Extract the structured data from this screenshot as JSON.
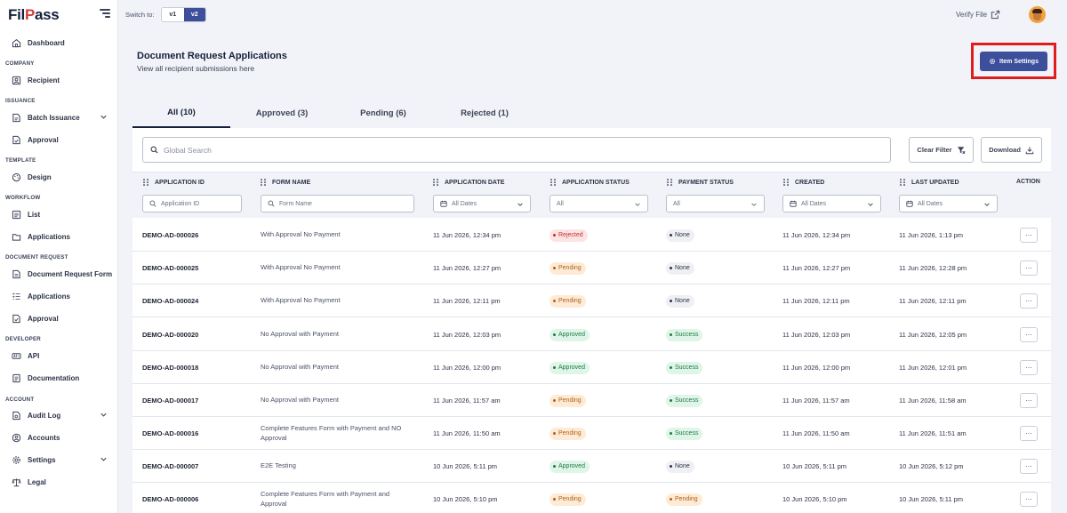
{
  "app": {
    "logo_main": "Fil",
    "logo_accent": "P",
    "logo_rest": "ass"
  },
  "sidebar": {
    "dashboard": "Dashboard",
    "sections": {
      "company": "COMPANY",
      "issuance": "ISSUANCE",
      "template": "TEMPLATE",
      "workflow": "WORKFLOW",
      "document_request": "DOCUMENT REQUEST",
      "developer": "DEVELOPER",
      "account": "ACCOUNT"
    },
    "items": {
      "recipient": "Recipient",
      "batch_issuance": "Batch Issuance",
      "approval": "Approval",
      "design": "Design",
      "list": "List",
      "applications": "Applications",
      "document_request_form": "Document Request Form",
      "dr_applications": "Applications",
      "dr_approval": "Approval",
      "api": "API",
      "documentation": "Documentation",
      "audit_log": "Audit Log",
      "accounts": "Accounts",
      "settings": "Settings",
      "legal": "Legal"
    }
  },
  "topbar": {
    "switch_label": "Switch to:",
    "v1": "v1",
    "v2": "v2",
    "verify_file": "Verify File"
  },
  "header": {
    "title": "Document Request Applications",
    "subtitle": "View all recipient submissions here",
    "item_settings": "Item Settings"
  },
  "tabs": [
    {
      "label": "All (10)"
    },
    {
      "label": "Approved (3)"
    },
    {
      "label": "Pending (6)"
    },
    {
      "label": "Rejected (1)"
    }
  ],
  "toolbar": {
    "search_placeholder": "Global Search",
    "clear_filter": "Clear Filter",
    "download": "Download"
  },
  "columns": {
    "application_id": "APPLICATION ID",
    "form_name": "FORM NAME",
    "application_date": "APPLICATION DATE",
    "application_status": "APPLICATION STATUS",
    "payment_status": "PAYMENT STATUS",
    "created": "CREATED",
    "last_updated": "LAST UPDATED",
    "action": "ACTION"
  },
  "filters": {
    "application_id": "Application ID",
    "form_name": "Form Name",
    "application_date": "All Dates",
    "application_status": "All",
    "payment_status": "All",
    "created": "All Dates",
    "last_updated": "All Dates"
  },
  "rows": [
    {
      "id": "DEMO-AD-000026",
      "form": "With Approval No Payment",
      "date": "11 Jun 2026, 12:34 pm",
      "status": "Rejected",
      "payment": "None",
      "created": "11 Jun 2026, 12:34 pm",
      "updated": "11 Jun 2026, 1:13 pm",
      "action": "···"
    },
    {
      "id": "DEMO-AD-000025",
      "form": "With Approval No Payment",
      "date": "11 Jun 2026, 12:27 pm",
      "status": "Pending",
      "payment": "None",
      "created": "11 Jun 2026, 12:27 pm",
      "updated": "11 Jun 2026, 12:28 pm",
      "action": "···"
    },
    {
      "id": "DEMO-AD-000024",
      "form": "With Approval No Payment",
      "date": "11 Jun 2026, 12:11 pm",
      "status": "Pending",
      "payment": "None",
      "created": "11 Jun 2026, 12:11 pm",
      "updated": "11 Jun 2026, 12:11 pm",
      "action": "···"
    },
    {
      "id": "DEMO-AD-000020",
      "form": "No Approval with Payment",
      "date": "11 Jun 2026, 12:03 pm",
      "status": "Approved",
      "payment": "Success",
      "created": "11 Jun 2026, 12:03 pm",
      "updated": "11 Jun 2026, 12:05 pm",
      "action": "···"
    },
    {
      "id": "DEMO-AD-000018",
      "form": "No Approval with Payment",
      "date": "11 Jun 2026, 12:00 pm",
      "status": "Approved",
      "payment": "Success",
      "created": "11 Jun 2026, 12:00 pm",
      "updated": "11 Jun 2026, 12:01 pm",
      "action": "···"
    },
    {
      "id": "DEMO-AD-000017",
      "form": "No Approval with Payment",
      "date": "11 Jun 2026, 11:57 am",
      "status": "Pending",
      "payment": "Success",
      "created": "11 Jun 2026, 11:57 am",
      "updated": "11 Jun 2026, 11:58 am",
      "action": "···"
    },
    {
      "id": "DEMO-AD-000016",
      "form": "Complete Features Form with Payment and NO Approval",
      "date": "11 Jun 2026, 11:50 am",
      "status": "Pending",
      "payment": "Success",
      "created": "11 Jun 2026, 11:50 am",
      "updated": "11 Jun 2026, 11:51 am",
      "action": "···"
    },
    {
      "id": "DEMO-AD-000007",
      "form": "E2E Testing",
      "date": "10 Jun 2026, 5:11 pm",
      "status": "Approved",
      "payment": "None",
      "created": "10 Jun 2026, 5:11 pm",
      "updated": "10 Jun 2026, 5:12 pm",
      "action": "···"
    },
    {
      "id": "DEMO-AD-000006",
      "form": "Complete Features Form with Payment and Approval",
      "date": "10 Jun 2026, 5:10 pm",
      "status": "Pending",
      "payment": "Pending",
      "created": "10 Jun 2026, 5:10 pm",
      "updated": "10 Jun 2026, 5:11 pm",
      "action": "···"
    }
  ]
}
